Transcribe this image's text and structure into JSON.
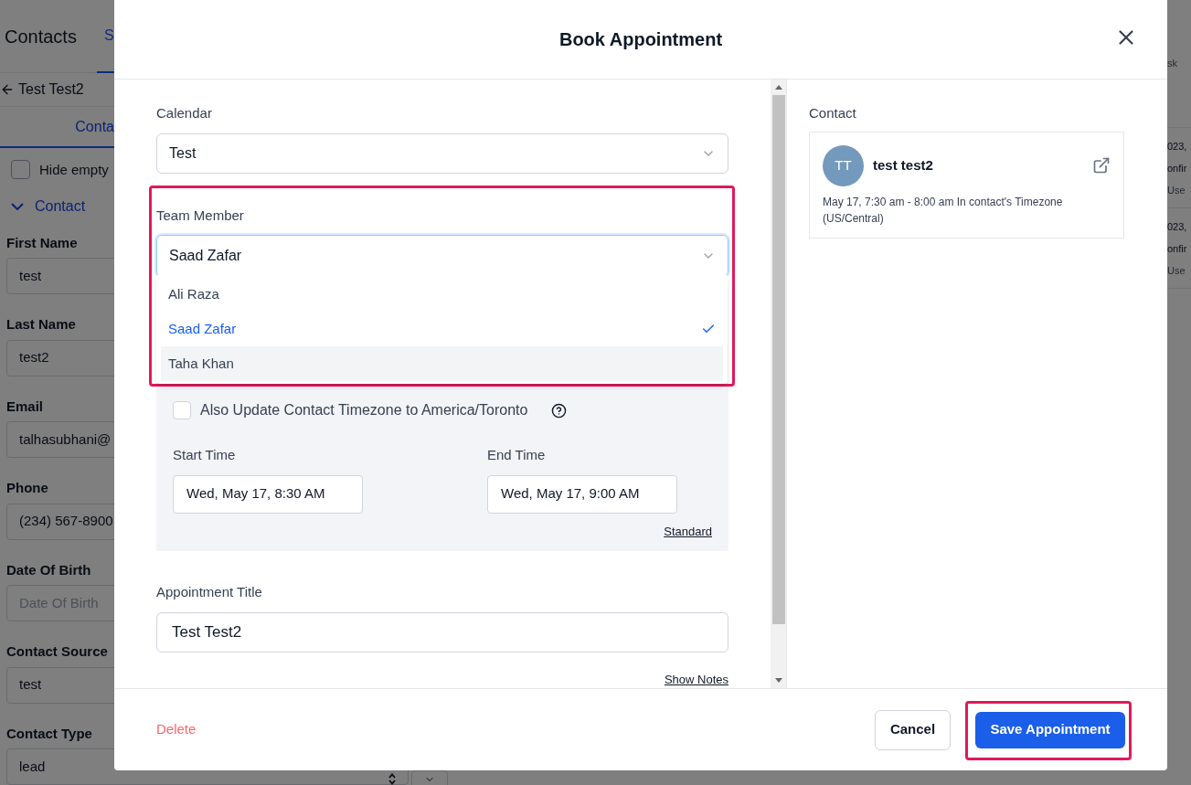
{
  "background_page": {
    "title": "Contacts",
    "tab": "S",
    "back_link": "Test Test2",
    "sub_tab": "Conta",
    "hide_empty": {
      "label": "Hide empty",
      "checked": false
    },
    "section": "Contact",
    "fields": [
      {
        "label": "First Name",
        "value": "test"
      },
      {
        "label": "Last Name",
        "value": "test2"
      },
      {
        "label": "Email",
        "value": "talhasubhani@"
      },
      {
        "label": "Phone",
        "value": "(234) 567-8900"
      },
      {
        "label": "Date Of Birth",
        "placeholder": "Date Of Birth"
      },
      {
        "label": "Contact Source",
        "value": "test"
      },
      {
        "label": "Contact Type",
        "value": "lead"
      }
    ],
    "right_header": "sk",
    "right_rows": [
      {
        "line_1": "023,",
        "line_2": "onfir",
        "line_3": "Use"
      },
      {
        "line_1": "023,",
        "line_2": "onfir",
        "line_3": "Use"
      }
    ]
  },
  "dialog": {
    "title": "Book Appointment",
    "calendar": {
      "label": "Calendar",
      "value": "Test"
    },
    "team_member": {
      "label": "Team Member",
      "value": "Saad Zafar",
      "expanded": true,
      "options": [
        {
          "label": "Ali Raza",
          "selected": false,
          "hovered": false
        },
        {
          "label": "Saad Zafar",
          "selected": true,
          "hovered": false
        },
        {
          "label": "Taha Khan",
          "selected": false,
          "hovered": true
        }
      ]
    },
    "update_timezone": {
      "label": "Also Update Contact Timezone to America/Toronto",
      "checked": false
    },
    "start_time": {
      "label": "Start Time",
      "value": "Wed, May 17, 8:30 AM"
    },
    "end_time": {
      "label": "End Time",
      "value": "Wed, May 17, 9:00 AM"
    },
    "standard_link": "Standard",
    "appointment_title": {
      "label": "Appointment Title",
      "value": "Test Test2"
    },
    "show_notes_link": "Show Notes",
    "contact_panel": {
      "label": "Contact",
      "initials": "TT",
      "name": "test test2",
      "details": "May 17, 7:30 am - 8:00 am In contact's Timezone (US/Central)"
    },
    "footer": {
      "delete": "Delete",
      "cancel": "Cancel",
      "save": "Save Appointment"
    }
  }
}
